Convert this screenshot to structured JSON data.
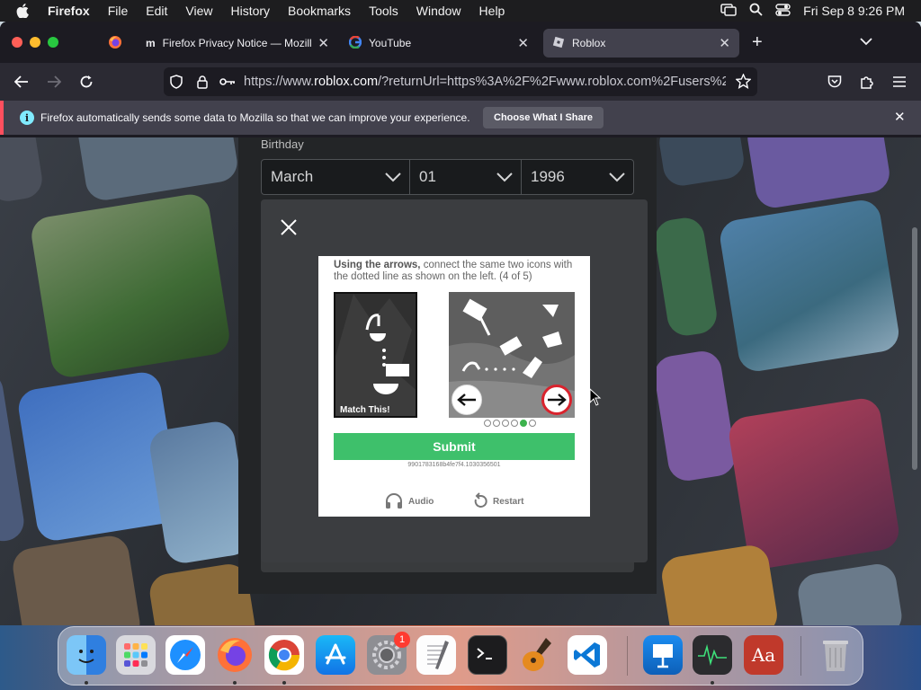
{
  "menubar": {
    "app_name": "Firefox",
    "items": [
      "File",
      "Edit",
      "View",
      "History",
      "Bookmarks",
      "Tools",
      "Window",
      "Help"
    ],
    "clock": "Fri Sep 8  9:26 PM"
  },
  "tabs": [
    {
      "title": "Firefox Privacy Notice — Mozilla",
      "active": false
    },
    {
      "title": "YouTube",
      "active": false
    },
    {
      "title": "Roblox",
      "active": true
    }
  ],
  "urlbar": {
    "url_prefix": "https://www.",
    "url_domain": "roblox.com",
    "url_rest": "/?returnUrl=https%3A%2F%2Fwww.roblox.com%2Fusers%2"
  },
  "infobar": {
    "message": "Firefox automatically sends some data to Mozilla so that we can improve your experience.",
    "button": "Choose What I Share"
  },
  "signup": {
    "birthday_label": "Birthday",
    "month": "March",
    "day": "01",
    "year": "1996"
  },
  "captcha": {
    "instructions_bold": "Using the arrows,",
    "instructions_rest": " connect the same two icons with the dotted line as shown on the left. (4 of 5)",
    "example_label": "Match This!",
    "submit_label": "Submit",
    "session_id": "9901783168b4fe7f4.1030356501",
    "audio_label": "Audio",
    "restart_label": "Restart",
    "progress_dots": 6,
    "progress_active_index": 4
  },
  "colors": {
    "submit_green": "#3ec06b",
    "arrow_red": "#d9232d",
    "infobar_accent": "#ff4f5e"
  },
  "dock": {
    "apps": [
      "Finder",
      "Launchpad",
      "Safari",
      "Firefox",
      "Google Chrome",
      "App Store",
      "System Settings",
      "TextEdit",
      "Terminal",
      "GarageBand",
      "Visual Studio Code",
      "Keynote",
      "Activity Monitor",
      "Dictionary",
      "Trash"
    ],
    "system_settings_badge": "1"
  }
}
